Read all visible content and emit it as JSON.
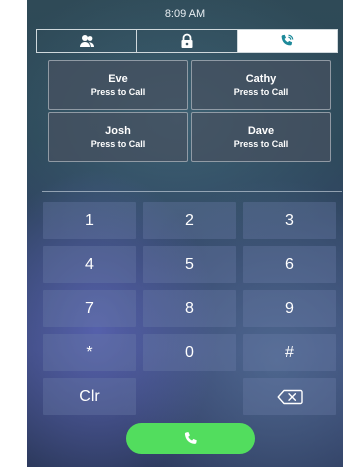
{
  "status": {
    "time": "8:09 AM"
  },
  "tabs": [
    {
      "icon": "contacts-icon",
      "active": false
    },
    {
      "icon": "lock-icon",
      "active": false
    },
    {
      "icon": "phone-ringing-icon",
      "active": true
    }
  ],
  "contacts": [
    {
      "name": "Eve",
      "action": "Press to Call"
    },
    {
      "name": "Cathy",
      "action": "Press to Call"
    },
    {
      "name": "Josh",
      "action": "Press to Call"
    },
    {
      "name": "Dave",
      "action": "Press to Call"
    }
  ],
  "keypad": {
    "keys": [
      "1",
      "2",
      "3",
      "4",
      "5",
      "6",
      "7",
      "8",
      "9",
      "*",
      "0",
      "#"
    ],
    "clear_label": "Clr",
    "backspace_icon": "backspace-icon"
  },
  "call_button": {
    "icon": "phone-icon",
    "color": "#52dd5e"
  }
}
